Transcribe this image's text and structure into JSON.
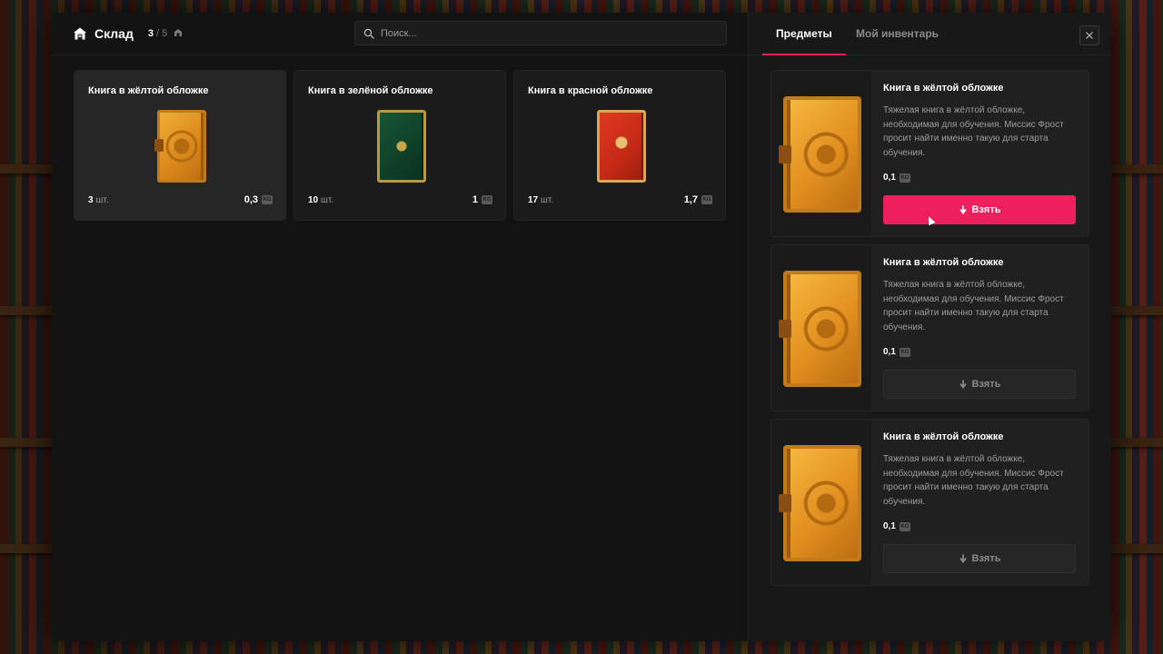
{
  "header": {
    "title": "Склад",
    "count_current": "3",
    "count_sep": "/",
    "count_max": "5",
    "home_icon": "home-icon",
    "box_icon": "box-icon"
  },
  "search": {
    "placeholder": "Поиск...",
    "icon": "search-icon"
  },
  "items": [
    {
      "name": "Книга в жёлтой обложке",
      "qty": "3",
      "unit": "шт.",
      "weight": "0,3",
      "cover": "yellow"
    },
    {
      "name": "Книга в зелёной обложке",
      "qty": "10",
      "unit": "шт.",
      "weight": "1",
      "cover": "green"
    },
    {
      "name": "Книга в красной обложке",
      "qty": "17",
      "unit": "шт.",
      "weight": "1,7",
      "cover": "red"
    }
  ],
  "kg_label": "KG",
  "tabs": [
    {
      "label": "Предметы",
      "active": true
    },
    {
      "label": "Мой инвентарь",
      "active": false
    }
  ],
  "details": [
    {
      "name": "Книга в жёлтой обложке",
      "description": "Тяжелая книга в жёлтой обложке, необходимая для обучения. Миссис Фрост просит найти именно такую для старта обучения.",
      "weight": "0,1",
      "take_label": "Взять",
      "primary": true
    },
    {
      "name": "Книга в жёлтой обложке",
      "description": "Тяжелая книга в жёлтой обложке, необходимая для обучения. Миссис Фрост просит найти именно такую для старта обучения.",
      "weight": "0,1",
      "take_label": "Взять",
      "primary": false
    },
    {
      "name": "Книга в жёлтой обложке",
      "description": "Тяжелая книга в жёлтой обложке, необходимая для обучения. Миссис Фрост просит найти именно такую для старта обучения.",
      "weight": "0,1",
      "take_label": "Взять",
      "primary": false
    }
  ],
  "colors": {
    "accent": "#ef1f5d",
    "panel": "#131313",
    "card": "#1b1b1b"
  }
}
